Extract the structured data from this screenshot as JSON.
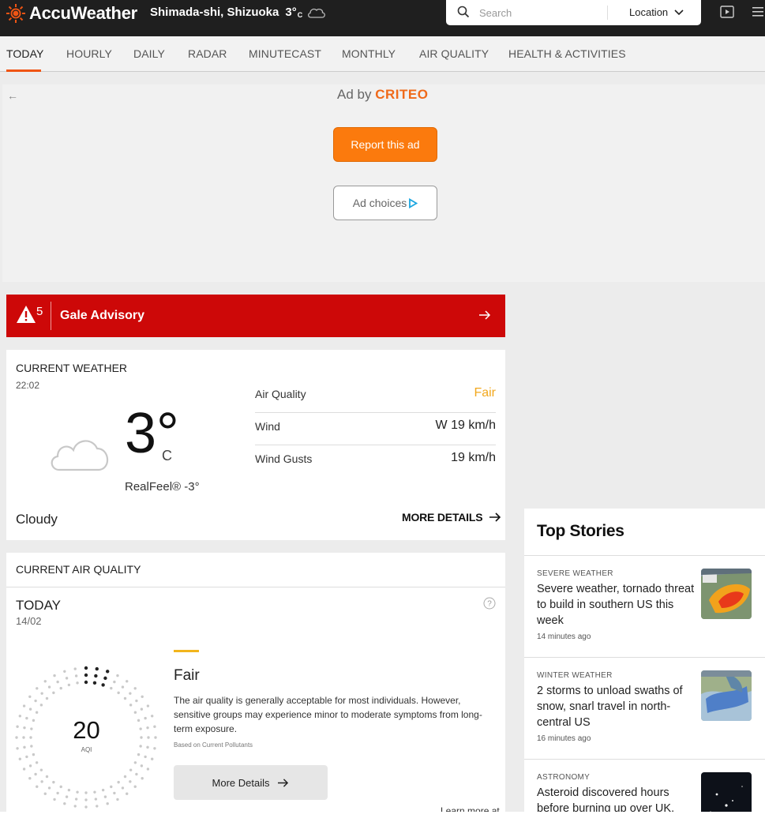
{
  "header": {
    "brand": "AccuWeather",
    "location": "Shimada-shi, Shizuoka",
    "temp": "3°",
    "temp_unit": "C",
    "search_placeholder": "Search",
    "location_button": "Location"
  },
  "nav": {
    "tabs": [
      {
        "label": "TODAY",
        "active": true
      },
      {
        "label": "HOURLY"
      },
      {
        "label": "DAILY"
      },
      {
        "label": "RADAR"
      },
      {
        "label": "MINUTECAST"
      },
      {
        "label": "MONTHLY"
      },
      {
        "label": "AIR QUALITY"
      },
      {
        "label": "HEALTH & ACTIVITIES"
      }
    ]
  },
  "ad": {
    "back": "←",
    "by": "Ad by",
    "brand": "CRITEO",
    "report": "Report this ad",
    "choices": "Ad choices"
  },
  "alert": {
    "count": "5",
    "title": "Gale Advisory"
  },
  "current_weather": {
    "title": "CURRENT WEATHER",
    "time": "22:02",
    "temp": "3°",
    "unit": "C",
    "realfeel": "RealFeel® -3°",
    "phrase": "Cloudy",
    "more_details": "MORE DETAILS",
    "details": [
      {
        "label": "Air Quality",
        "value": "Fair"
      },
      {
        "label": "Wind",
        "value": "W 19 km/h"
      },
      {
        "label": "Wind Gusts",
        "value": "19 km/h"
      }
    ],
    "colors": {
      "fair": "#f2a81e"
    }
  },
  "air_quality": {
    "title": "CURRENT AIR QUALITY",
    "day": "TODAY",
    "date": "14/02",
    "aqi": "20",
    "aqi_label": "AQI",
    "aqi_fraction": 0.08,
    "category": "Fair",
    "description": "The air quality is generally acceptable for most individuals. However, sensitive groups may experience minor to moderate symptoms from long-term exposure.",
    "based_on": "Based on Current Pollutants",
    "more_details": "More Details",
    "learn_more": "Learn more at"
  },
  "top_stories": {
    "title": "Top Stories",
    "items": [
      {
        "category": "SEVERE WEATHER",
        "headline": "Severe weather, tornado threat to build in southern US this week",
        "time": "14 minutes ago"
      },
      {
        "category": "WINTER WEATHER",
        "headline": "2 storms to unload swaths of snow, snarl travel in north-central US",
        "time": "16 minutes ago"
      },
      {
        "category": "ASTRONOMY",
        "headline": "Asteroid discovered hours before burning up over UK.",
        "time": ""
      }
    ]
  }
}
